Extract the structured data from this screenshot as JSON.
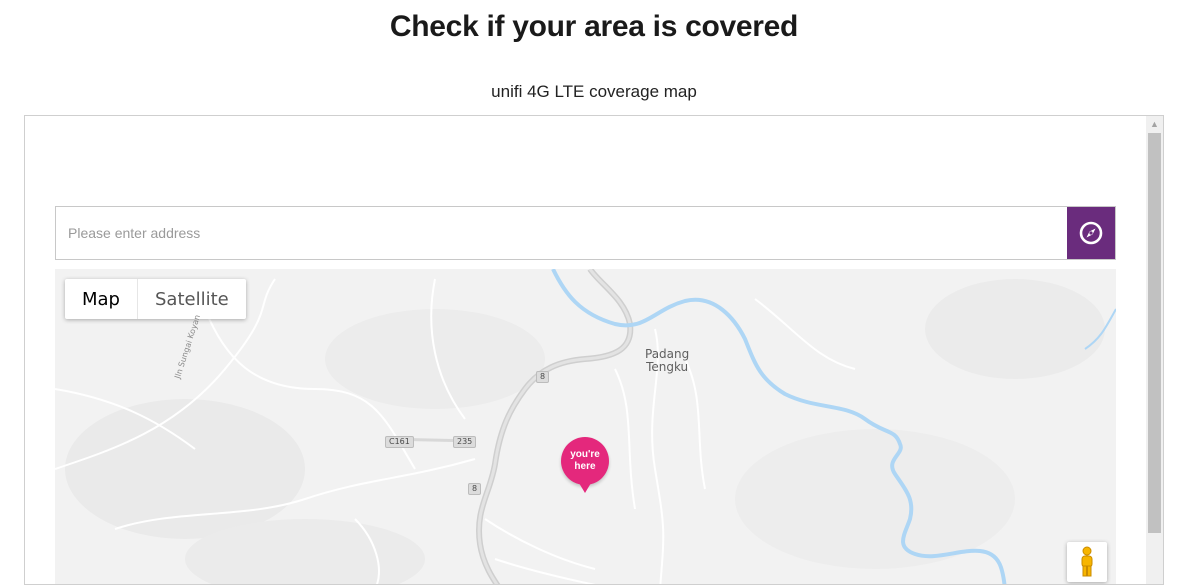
{
  "page": {
    "title": "Check if your area is covered",
    "subtitle": "unifi 4G LTE coverage map"
  },
  "search": {
    "placeholder": "Please enter address",
    "value": "",
    "locate_icon": "compass-icon",
    "accent_color": "#6a2c7d"
  },
  "map": {
    "type_toggle": {
      "map_label": "Map",
      "satellite_label": "Satellite",
      "selected": "Map"
    },
    "place_labels": {
      "town": "Padang\nTengku",
      "road_name": "Jln Sungai Koyan"
    },
    "road_shields": [
      "8",
      "C161",
      "235",
      "8"
    ],
    "marker": {
      "label": "you're\nhere",
      "color": "#e4287c"
    },
    "street_view_icon": "pegman-icon"
  }
}
